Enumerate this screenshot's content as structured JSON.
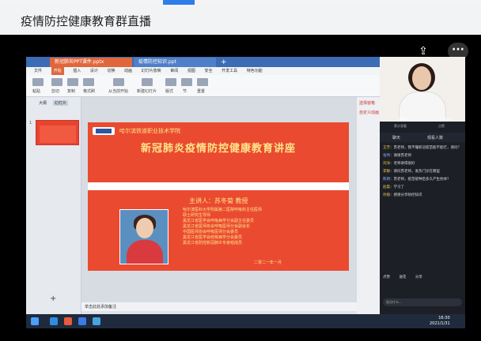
{
  "window": {
    "title": "疫情防控健康教育群直播"
  },
  "icons": {
    "share": "share-screen-icon",
    "more": "more-icon"
  },
  "tabs": [
    {
      "label": "新冠肺炎PPT课件.pptx"
    },
    {
      "label": "疫情防控知识.ppt"
    }
  ],
  "menu": [
    "文件",
    "开始",
    "插入",
    "设计",
    "切换",
    "动画",
    "幻灯片放映",
    "审阅",
    "视图",
    "安全",
    "开发工具",
    "特色功能"
  ],
  "ribbon": [
    "粘贴",
    "剪切",
    "复制",
    "格式刷",
    "从当前开始",
    "新建幻灯片",
    "版式",
    "节",
    "重置"
  ],
  "leftpane": {
    "tab1": "大纲",
    "tab2": "幻灯片",
    "slide_number": "1"
  },
  "slide": {
    "school": "哈尔滨铁道职业技术学院",
    "headline": "新冠肺炎疫情防控健康教育讲座",
    "speaker": "主讲人：苏冬菊   教授",
    "bio": [
      "哈尔滨医科大学附属第二医院呼吸科主任医师",
      "硕士研究生导师",
      "黑龙江省医学会呼吸病学分会副主任委员",
      "黑龙江省医师协会呼吸医师分会副会长",
      "中国医师协会呼吸医师分会委员",
      "黑龙江省医学会结核病学分会委员",
      "黑龙江省防控新冠肺炎专家组成员"
    ],
    "date": "二零二一年一月"
  },
  "notes": "单击此处添加备注",
  "rightpane": [
    "选择窗格",
    "自定义动画"
  ],
  "status": {
    "left": "幻灯片 1 / 1",
    "zoom": "63%"
  },
  "live": {
    "stats": [
      {
        "value": "283",
        "label": "累计观看"
      },
      {
        "value": "1107",
        "label": "点赞"
      }
    ],
    "panel_tabs": [
      "聊天",
      "观看人数"
    ],
    "messages": [
      {
        "user": "王芳",
        "text": "苏老师，我不懂新冠疫苗能不能打，请问？"
      },
      {
        "user": "张伟",
        "text": "谢谢苏老师"
      },
      {
        "user": "刘洋",
        "text": "老师讲得很好"
      },
      {
        "user": "李静",
        "text": "请问苏老师，发热门诊在哪里"
      },
      {
        "user": "陈明",
        "text": "苏老师，疫苗接种后多久产生抗体？"
      },
      {
        "user": "赵磊",
        "text": "学习了"
      },
      {
        "user": "孙丽",
        "text": "感谢分享防控知识"
      }
    ],
    "bottom_buttons": [
      "点赞",
      "送花",
      "分享"
    ],
    "input_placeholder": "说点什么…"
  },
  "clock": {
    "time": "16:30",
    "date": "2021/1/31"
  }
}
